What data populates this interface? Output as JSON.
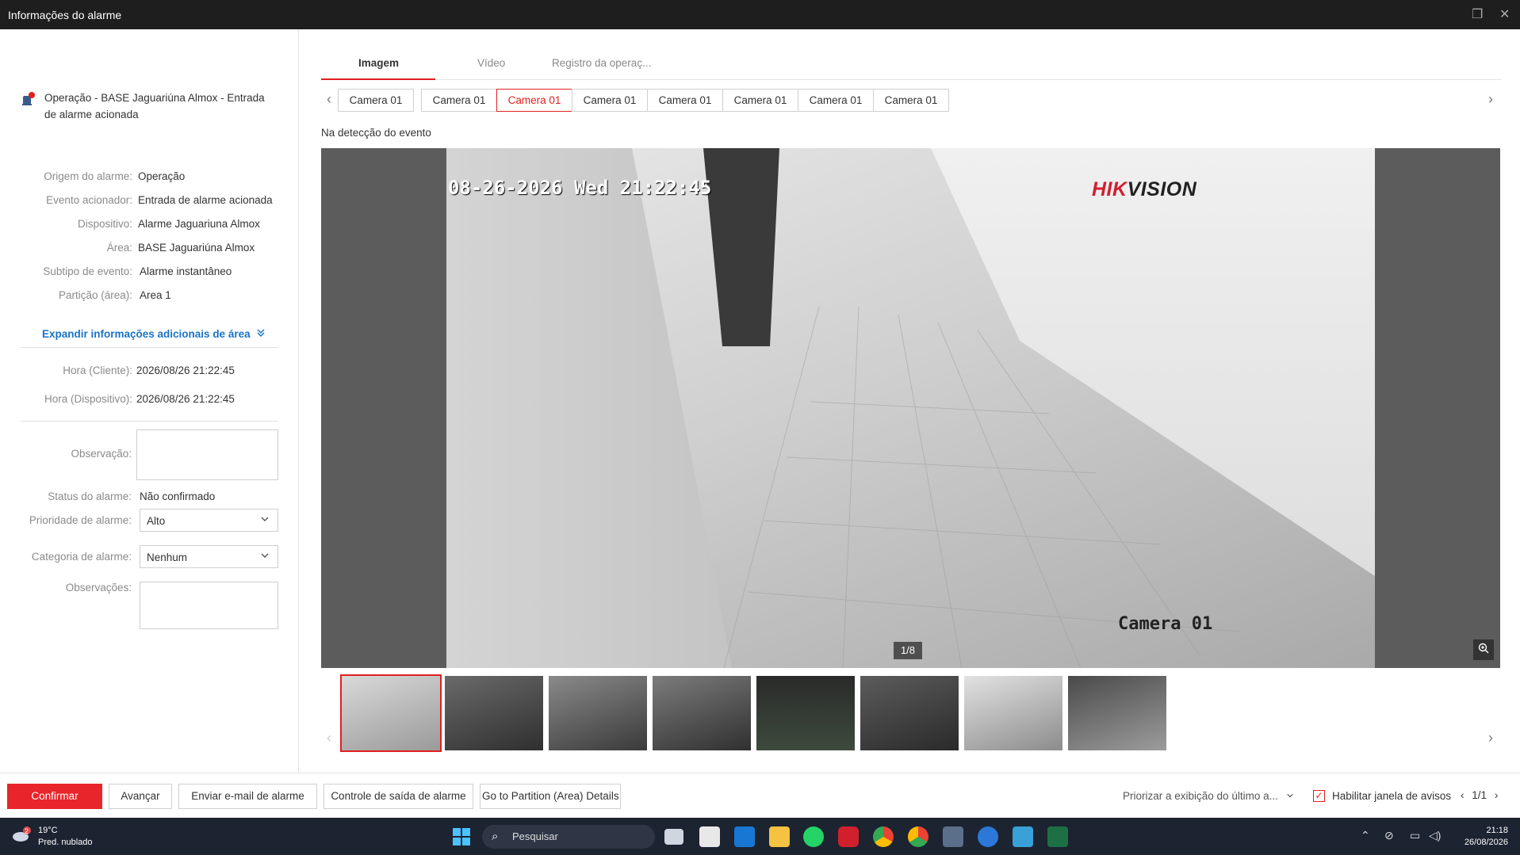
{
  "window": {
    "title": "Informações do alarme"
  },
  "alarm": {
    "heading": "Operação - BASE Jaguariúna Almox - Entrada de alarme acionada"
  },
  "info": [
    {
      "label": "Origem do alarme:",
      "value": "Operação"
    },
    {
      "label": "Evento acionador:",
      "value": "Entrada de alarme acionada"
    },
    {
      "label": "Dispositivo:",
      "value": "Alarme Jaguariuna Almox"
    },
    {
      "label": "Área:",
      "value": "BASE Jaguariúna Almox"
    },
    {
      "label": "Subtipo de evento:",
      "value": "Alarme instantâneo"
    },
    {
      "label": "Partição (área):",
      "value": "Area 1"
    }
  ],
  "expand_label": "Expandir informações adicionais de área",
  "times": [
    {
      "label": "Hora (Cliente):",
      "value": "2026/08/26 21:22:45"
    },
    {
      "label": "Hora (Dispositivo):",
      "value": "2026/08/26 21:22:45"
    }
  ],
  "form": {
    "observation_label": "Observação:",
    "status_label": "Status do alarme:",
    "status_value": "Não confirmado",
    "priority_label": "Prioridade de alarme:",
    "priority_value": "Alto",
    "category_label": "Categoria de alarme:",
    "category_value": "Nenhum",
    "notes_label": "Observações:"
  },
  "tabs": [
    "Imagem",
    "Vídeo",
    "Registro da operaç..."
  ],
  "cameras": [
    "Camera 01",
    "Camera 01",
    "Camera 01",
    "Camera 01",
    "Camera 01",
    "Camera 01",
    "Camera 01",
    "Camera 01"
  ],
  "active_camera_index": 2,
  "event_label": "Na detecção do evento",
  "viewer": {
    "osd_time": "08-26-2026 Wed 21:22:45",
    "brand_a": "HIK",
    "brand_b": "VISION",
    "osd_camera": "Camera 01",
    "counter": "1/8"
  },
  "thumbnail_count": 8,
  "bottom": {
    "confirm": "Confirmar",
    "advance": "Avançar",
    "send_email": "Enviar e-mail de alarme",
    "output_control": "Controle de saída de alarme",
    "partition_details": "Go to Partition (Area) Details",
    "prioritize": "Priorizar a exibição do último a...",
    "enable_popup": "Habilitar janela de avisos",
    "pager": "1/1"
  },
  "taskbar": {
    "weather_temp": "19°C",
    "weather_desc": "Pred. nublado",
    "weather_badge": "2",
    "search_placeholder": "Pesquisar",
    "time": "21:18",
    "date": "26/08/2026"
  },
  "colors": {
    "accent": "#e02020",
    "link": "#1a73c9",
    "titlebar": "#1e1e1e",
    "taskbar": "#1c2331"
  }
}
